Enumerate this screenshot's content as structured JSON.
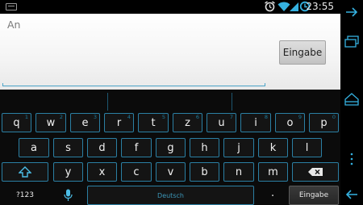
{
  "status_bar": {
    "time": "23:55"
  },
  "editor": {
    "text": "An",
    "action_button": "Eingabe"
  },
  "keyboard": {
    "row1": [
      {
        "k": "q",
        "h": "1"
      },
      {
        "k": "w",
        "h": "2"
      },
      {
        "k": "e",
        "h": "3"
      },
      {
        "k": "r",
        "h": "4"
      },
      {
        "k": "t",
        "h": "5"
      },
      {
        "k": "z",
        "h": "6"
      },
      {
        "k": "u",
        "h": "7"
      },
      {
        "k": "i",
        "h": "8"
      },
      {
        "k": "o",
        "h": "9"
      },
      {
        "k": "p",
        "h": "0"
      }
    ],
    "row2": [
      "a",
      "s",
      "d",
      "f",
      "g",
      "h",
      "j",
      "k",
      "l"
    ],
    "row3": [
      "y",
      "x",
      "c",
      "v",
      "b",
      "n",
      "m"
    ],
    "symbols_label": "?123",
    "space_label": "Deutsch",
    "period": ".",
    "enter_label": "Eingabe"
  },
  "colors": {
    "accent": "#33b5e5",
    "key_border": "#2b7fa3"
  }
}
